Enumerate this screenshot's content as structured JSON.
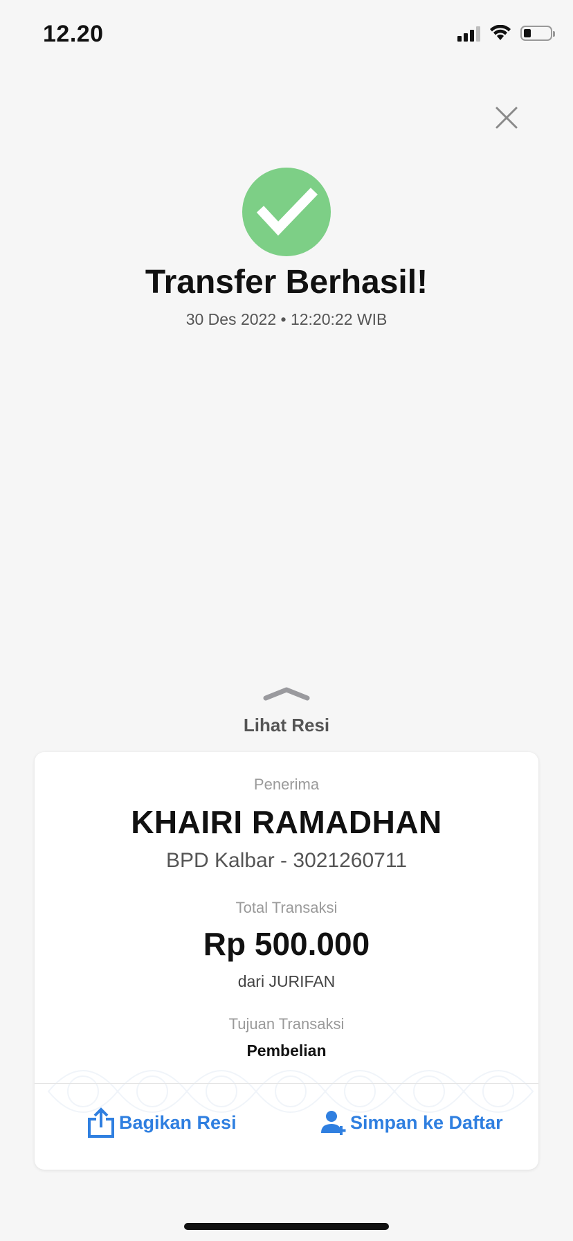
{
  "status_bar": {
    "time": "12.20"
  },
  "success": {
    "title": "Transfer Berhasil!",
    "datetime": "30 Des 2022 • 12:20:22 WIB",
    "color": "#7dcf86"
  },
  "receipt_toggle": {
    "label": "Lihat Resi"
  },
  "receipt": {
    "recipient_label": "Penerima",
    "recipient_name": "KHAIRI RAMADHAN",
    "recipient_account": "BPD Kalbar - 3021260711",
    "total_label": "Total Transaksi",
    "total_amount": "Rp 500.000",
    "sender": "dari JURIFAN",
    "purpose_label": "Tujuan Transaksi",
    "purpose_value": "Pembelian"
  },
  "actions": {
    "share_label": "Bagikan Resi",
    "save_label": "Simpan ke Daftar",
    "accent_color": "#2f7fe0"
  },
  "icons": {
    "close": "close-icon",
    "success": "checkmark-icon",
    "share": "share-icon",
    "add_contact": "add-contact-icon"
  }
}
